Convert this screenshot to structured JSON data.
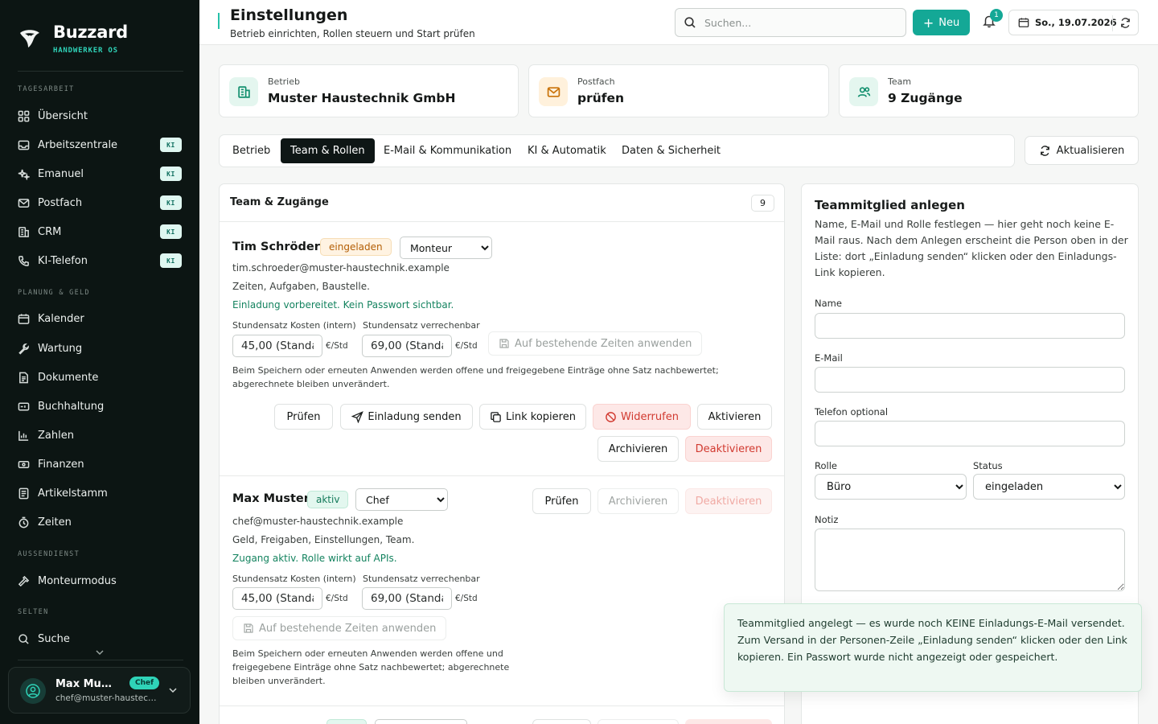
{
  "brand": {
    "name": "Buzzard",
    "subtitle": "HANDWERKER OS"
  },
  "sidebar": {
    "sections": {
      "daily": "TAGESARBEIT",
      "planning": "PLANUNG & GELD",
      "field": "AUSSENDIENST",
      "rare": "SELTEN"
    },
    "items": [
      {
        "label": "Übersicht",
        "icon": "grid-icon",
        "ki": false
      },
      {
        "label": "Arbeitszentrale",
        "icon": "inbox-icon",
        "ki": true
      },
      {
        "label": "Emanuel",
        "icon": "sparkles-icon",
        "ki": true
      },
      {
        "label": "Postfach",
        "icon": "mail-icon",
        "ki": true
      },
      {
        "label": "CRM",
        "icon": "building-icon",
        "ki": true
      },
      {
        "label": "KI-Telefon",
        "icon": "phone-icon",
        "ki": true
      },
      {
        "label": "Kalender",
        "icon": "calendar-icon",
        "ki": false
      },
      {
        "label": "Wartung",
        "icon": "wrench-icon",
        "ki": false
      },
      {
        "label": "Dokumente",
        "icon": "document-icon",
        "ki": false
      },
      {
        "label": "Buchhaltung",
        "icon": "ledger-icon",
        "ki": false
      },
      {
        "label": "Zahlen",
        "icon": "bar-chart-icon",
        "ki": false
      },
      {
        "label": "Finanzen",
        "icon": "banknote-icon",
        "ki": false
      },
      {
        "label": "Artikelstamm",
        "icon": "list-icon",
        "ki": false
      },
      {
        "label": "Zeiten",
        "icon": "stopwatch-icon",
        "ki": false
      },
      {
        "label": "Monteurmodus",
        "icon": "hammer-icon",
        "ki": false
      },
      {
        "label": "Suche",
        "icon": "search-icon",
        "ki": false
      }
    ],
    "ki_label": "KI"
  },
  "user": {
    "name": "Max Muster",
    "email": "chef@muster-haustechnik.example",
    "role": "Chef"
  },
  "header": {
    "title": "Einstellungen",
    "subtitle": "Betrieb einrichten, Rollen steuern und Start prüfen",
    "search_placeholder": "Suchen...",
    "new_label": "Neu",
    "notification_count": "1",
    "date": "So., 19.07.2026"
  },
  "stats": [
    {
      "label": "Betrieb",
      "value": "Muster Haustechnik GmbH",
      "icon": "building-icon"
    },
    {
      "label": "Postfach",
      "value": "prüfen",
      "icon": "mail-icon"
    },
    {
      "label": "Team",
      "value": "9 Zugänge",
      "icon": "users-icon"
    }
  ],
  "tabs": [
    "Betrieb",
    "Team & Rollen",
    "E-Mail & Kommunikation",
    "KI & Automatik",
    "Daten & Sicherheit"
  ],
  "active_tab": "Team & Rollen",
  "refresh_label": "Aktualisieren",
  "team": {
    "title": "Team & Zugänge",
    "count": "9",
    "rate_cost_label": "Stundensatz Kosten (intern)",
    "rate_bill_label": "Stundensatz verrechenbar",
    "unit": "€/Std",
    "apply_label": "Auf bestehende Zeiten anwenden",
    "people": [
      {
        "name": "Tim Schröder",
        "status": "eingeladen",
        "role": "Monteur",
        "email": "tim.schroeder@muster-haustechnik.example",
        "scope": "Zeiten, Aufgaben, Baustelle.",
        "state_text": "Einladung vorbereitet. Kein Passwort sichtbar.",
        "rate_cost": "45,00 (Standa",
        "rate_bill": "69,00 (Standa",
        "note": "Beim Speichern oder erneuten Anwenden werden offene und freigegebene Einträge ohne Satz nachbewertet; abgerechnete bleiben unverändert.",
        "actions": [
          "Prüfen",
          "Einladung senden",
          "Link kopieren",
          "Widerrufen",
          "Aktivieren",
          "Archivieren",
          "Deaktivieren"
        ]
      },
      {
        "name": "Max Muster",
        "status": "aktiv",
        "role": "Chef",
        "email": "chef@muster-haustechnik.example",
        "scope": "Geld, Freigaben, Einstellungen, Team.",
        "state_text": "Zugang aktiv. Rolle wirkt auf APIs.",
        "rate_cost": "45,00 (Standa",
        "rate_bill": "69,00 (Standa",
        "note": "Beim Speichern oder erneuten Anwenden werden offene und freigegebene Einträge ohne Satz nachbewertet; abgerechnete bleiben unverändert.",
        "actions": [
          "Prüfen",
          "Archivieren",
          "Deaktivieren"
        ]
      }
    ],
    "role_options": [
      "Monteur",
      "Chef",
      "Büro"
    ]
  },
  "form": {
    "title": "Teammitglied anlegen",
    "description": "Name, E-Mail und Rolle festlegen — hier geht noch keine E-Mail raus. Nach dem Anlegen erscheint die Person oben in der Liste: dort „Einladung senden“ klicken oder den Einladungs-Link kopieren.",
    "name_label": "Name",
    "email_label": "E-Mail",
    "phone_label": "Telefon optional",
    "role_label": "Rolle",
    "role_value": "Büro",
    "status_label": "Status",
    "status_value": "eingeladen",
    "note_label": "Notiz"
  },
  "toast": {
    "text": "Teammitglied angelegt — es wurde noch KEINE Einladungs-E-Mail versendet. Zum Versand in der Personen-Zeile „Einladung senden“ klicken oder den Link kopieren. Ein Passwort wurde nicht angezeigt oder gespeichert."
  },
  "colors": {
    "accent": "#14a896",
    "sidebar_bg": "#0c1513",
    "danger": "#d13a30",
    "success": "#14835f",
    "warning": "#b35e05"
  }
}
